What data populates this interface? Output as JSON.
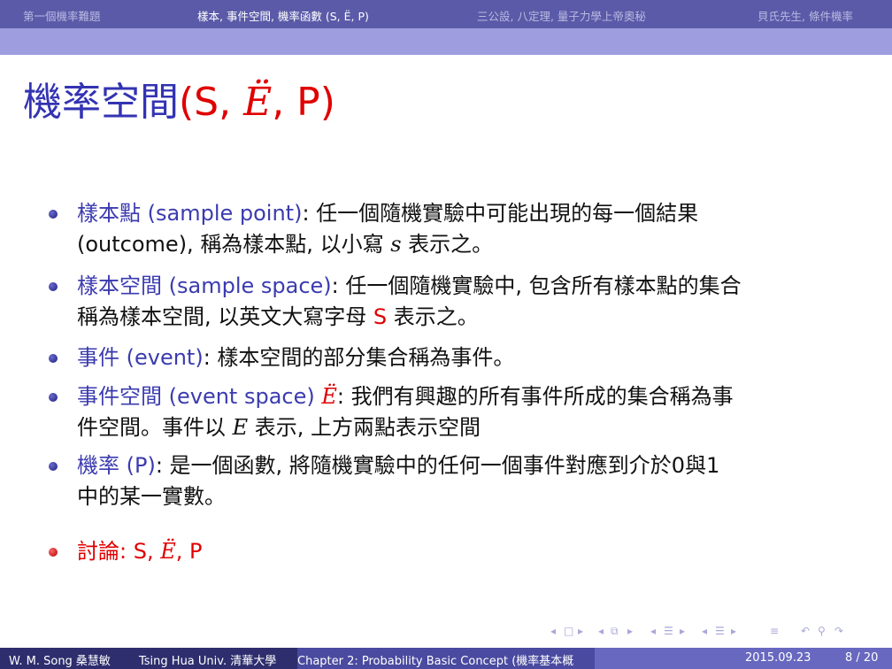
{
  "nav": {
    "items": [
      {
        "label": "第一個機率難題"
      },
      {
        "label": "樣本, 事件空間, 機率函數 (S, Ë, P)"
      },
      {
        "label": "三公設, 八定理, 量子力學上帝奧秘"
      },
      {
        "label": "貝氏先生, 條件機率"
      }
    ]
  },
  "slide": {
    "title_cn": "機率空間",
    "title_open": "(S, ",
    "title_e": "Ë",
    "title_close": ", P)",
    "bullets": [
      {
        "term": "樣本點 (sample point)",
        "line1_rest": ": 任一個隨機實驗中可能出現的每一個結果",
        "line2_a": "(outcome), 稱為樣本點, 以小寫 ",
        "line2_sym": "s",
        "line2_b": " 表示之。"
      },
      {
        "term": "樣本空間 (sample space)",
        "line1_rest": ": 任一個隨機實驗中, 包含所有樣本點的集合",
        "line2_a": "稱為樣本空間, 以英文大寫字母 ",
        "line2_sym": "S",
        "line2_b": " 表示之。"
      },
      {
        "term": "事件 (event)",
        "line1_rest": ": 樣本空間的部分集合稱為事件。"
      },
      {
        "term": "事件空間 (event space) ",
        "term_sym": "Ë",
        "line1_rest": ": 我們有興趣的所有事件所成的集合稱為事",
        "line2_a": "件空間。事件以 ",
        "line2_sym": "E",
        "line2_b": " 表示, 上方兩點表示空間"
      },
      {
        "term": "機率 (P)",
        "line1_rest": ": 是一個函數, 將隨機實驗中的任何一個事件對應到介於0與1",
        "line2_a": "中的某一實數。"
      },
      {
        "term": "討論: S, ",
        "term_sym": "Ë",
        "term_tail": ", P"
      }
    ]
  },
  "footer": {
    "author": "W. M. Song 桑慧敏",
    "institute": "Tsing Hua Univ. 清華大學",
    "short_title": "Chapter 2: Probability Basic Concept (機率基本概",
    "date": "2015.09.23",
    "page": "8 / 20"
  },
  "colors": {
    "nav_bar": "#5a5aa8",
    "sub_bar": "#9d9de0",
    "title_blue": "#3333b3",
    "accent_red": "#e00000",
    "footer_dark": "#2e2e6e",
    "footer_mid": "#4a4aa0",
    "footer_light": "#6868c0"
  },
  "icons": {
    "nav_symbols": [
      "frame-prev-icon",
      "frame-next-icon",
      "subsection-prev-icon",
      "subsection-next-icon",
      "section-prev-icon",
      "section-next-icon",
      "align-icon",
      "search-icon",
      "back-forward-icon"
    ]
  }
}
